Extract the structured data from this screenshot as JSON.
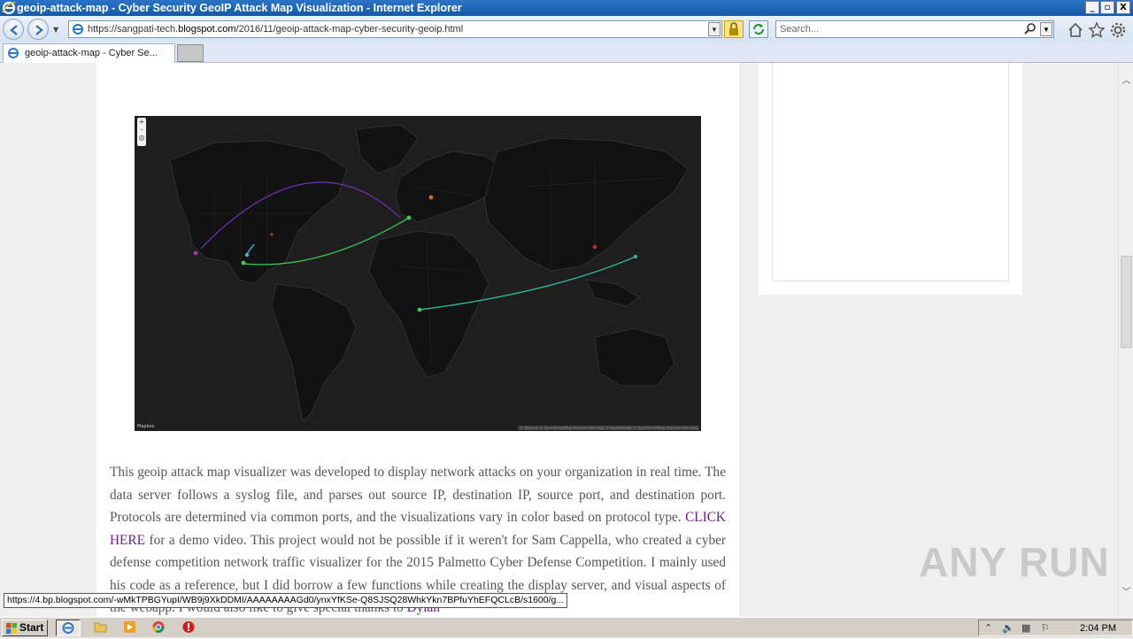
{
  "window": {
    "title": "geoip-attack-map - Cyber Security GeoIP Attack Map Visualization - Internet Explorer",
    "buttons": {
      "minimize": "_",
      "maximize": "▫",
      "close": "X"
    }
  },
  "address_bar": {
    "url_prefix": "https://sangpati-tech.",
    "url_domain": "blogspot.com",
    "url_path": "/2016/11/geoip-attack-map-cyber-security-geoip.html",
    "dropdown": "▼"
  },
  "search": {
    "placeholder": "Search...",
    "dropdown": "▼"
  },
  "tabs": [
    {
      "label": "geoip-attack-map - Cyber Se..."
    }
  ],
  "map": {
    "zoom_in": "+",
    "zoom_out": "-",
    "logo": "Mapbox",
    "attribution": "© Mapbox © OpenStreetMap Improve this map © DigitalGlobe © OpenStreetMap Improve this map"
  },
  "article": {
    "p1_before_link": "This geoip attack map visualizer was developed to display network attacks on your organization in real time. The data server follows a syslog file, and parses out source IP, destination IP, source port, and destination port. Protocols are determined via common ports, and the visualizations vary in color based on protocol type. ",
    "p1_link": "CLICK HERE",
    "p1_after_link": " for a demo video. This project would not be possible if it weren't for Sam Cappella, who created a cyber defense competition network traffic visualizer for the 2015 Palmetto Cyber Defense Competition. I mainly used his code as a reference, but I did borrow a few functions while creating the display server, and visual aspects of the webapp. I would also like to give special thanks to ",
    "p1_link2": "Dylan"
  },
  "status_bar": {
    "url": "https://4.bp.blogspot.com/-wMkTPBGYupI/WB9j9XkDDMI/AAAAAAAAGd0/ynxYfKSe-Q8SJSQ28WhkYkn7BPfuYhEFQCLcB/s1600/g..."
  },
  "watermark": "ANY RUN",
  "taskbar": {
    "start_label": "Start",
    "clock": "2:04 PM"
  },
  "colors": {
    "titlebar": "#1b62b0",
    "link": "#6c1b8f",
    "map_bg": "#1e1e1e",
    "arc_green": "#2ebd4f",
    "arc_purple": "#6a2fb0",
    "arc_teal": "#2bb59a"
  }
}
